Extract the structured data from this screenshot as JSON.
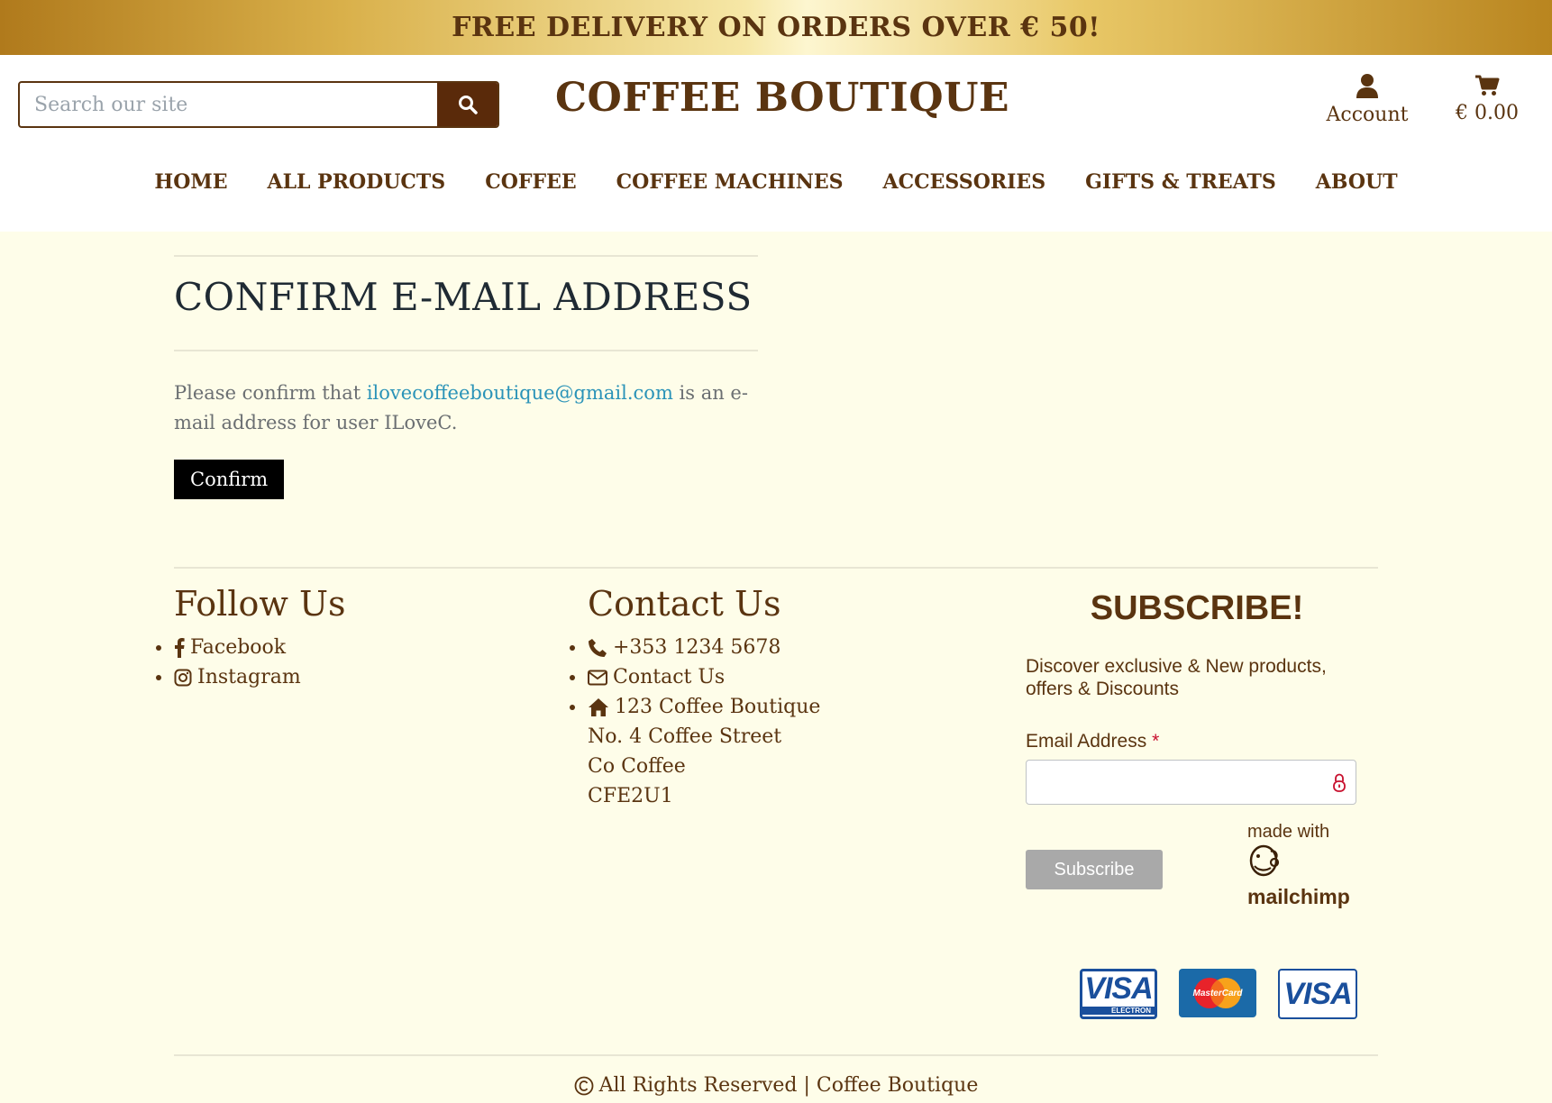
{
  "banner": {
    "text": "FREE DELIVERY ON ORDERS OVER € 50!"
  },
  "header": {
    "search_placeholder": "Search our site",
    "logo": "COFFEE BOUTIQUE",
    "account_label": "Account",
    "cart_total": "€ 0.00"
  },
  "nav": {
    "items": [
      "HOME",
      "ALL PRODUCTS",
      "COFFEE",
      "COFFEE MACHINES",
      "ACCESSORIES",
      "GIFTS & TREATS",
      "ABOUT"
    ]
  },
  "main": {
    "title": "CONFIRM E-MAIL ADDRESS",
    "msg_before": "Please confirm that ",
    "email": "ilovecoffeeboutique@gmail.com",
    "msg_after": " is an e-mail address for user ILoveC.",
    "confirm_label": "Confirm"
  },
  "footer": {
    "follow": {
      "heading": "Follow Us",
      "links": [
        "Facebook",
        "Instagram"
      ]
    },
    "contact": {
      "heading": "Contact Us",
      "phone": "+353 1234 5678",
      "contact_link": "Contact Us",
      "address": [
        "123 Coffee Boutique",
        "No. 4 Coffee Street",
        "Co Coffee",
        "CFE2U1"
      ]
    },
    "subscribe": {
      "heading": "SUBSCRIBE!",
      "description": "Discover exclusive & New products, offers & Discounts",
      "email_label": "Email Address ",
      "required_mark": "*",
      "button": "Subscribe",
      "made_with": "made with",
      "brand": "mailchimp"
    },
    "cards": [
      "VISA",
      "MasterCard",
      "VISA"
    ],
    "card_sub": "ELECTRON",
    "copyright": "All Rights Reserved | Coffee Boutique"
  },
  "colors": {
    "brand": "#5a3410",
    "background": "#fefde9",
    "link": "#2a93b8",
    "button": "#000000"
  }
}
